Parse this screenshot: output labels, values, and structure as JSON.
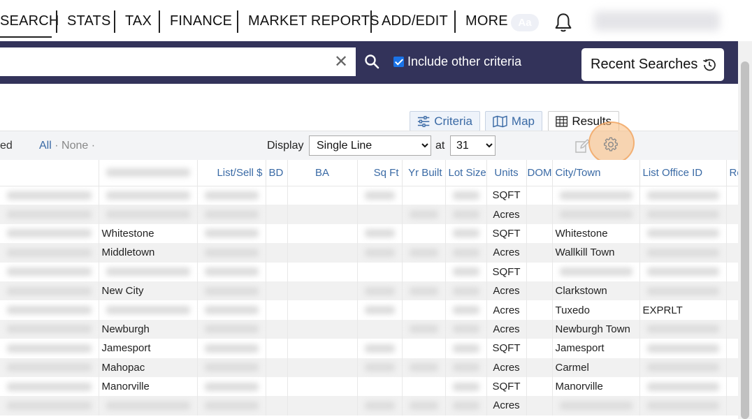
{
  "nav": {
    "items": [
      "SEARCH",
      "STATS",
      "TAX",
      "FINANCE",
      "MARKET REPORTS",
      "ADD/EDIT",
      "MORE"
    ],
    "aa_label": "Aa"
  },
  "search": {
    "value": "",
    "include_label": "Include other criteria",
    "include_checked": true,
    "recent_label": "Recent Searches"
  },
  "views": {
    "criteria_label": "Criteria",
    "map_label": "Map",
    "results_label": "Results"
  },
  "toolbar": {
    "ed_text": "ed",
    "all_label": "All",
    "none_label": "None",
    "dot": "·",
    "display_label": "Display",
    "display_value": "Single Line",
    "at_label": "at",
    "at_value": "31"
  },
  "table": {
    "columns": [
      "",
      "",
      "List/Sell $",
      "BD",
      "BA",
      "Sq Ft",
      "Yr Built",
      "Lot Size",
      "Units",
      "DOM",
      "City/Town",
      "List Office ID",
      "Re"
    ],
    "rows": [
      {
        "area": "",
        "units": "SQFT",
        "city": "",
        "office": ""
      },
      {
        "area": "",
        "units": "Acres",
        "city": "",
        "office": ""
      },
      {
        "area": "Whitestone",
        "units": "SQFT",
        "city": "Whitestone",
        "office": ""
      },
      {
        "area": "Middletown",
        "units": "Acres",
        "city": "Wallkill Town",
        "office": ""
      },
      {
        "area": "",
        "units": "SQFT",
        "city": "",
        "office": ""
      },
      {
        "area": "New City",
        "units": "Acres",
        "city": "Clarkstown",
        "office": ""
      },
      {
        "area": "",
        "units": "Acres",
        "city": "Tuxedo",
        "office": "EXPRLT"
      },
      {
        "area": "Newburgh",
        "units": "Acres",
        "city": "Newburgh Town",
        "office": ""
      },
      {
        "area": "Jamesport",
        "units": "SQFT",
        "city": "Jamesport",
        "office": ""
      },
      {
        "area": "Mahopac",
        "units": "Acres",
        "city": "Carmel",
        "office": ""
      },
      {
        "area": "Manorville",
        "units": "SQFT",
        "city": "Manorville",
        "office": ""
      },
      {
        "area": "",
        "units": "Acres",
        "city": "",
        "office": ""
      }
    ]
  }
}
